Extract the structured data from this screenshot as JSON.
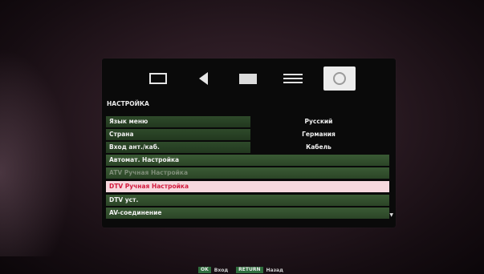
{
  "menu": {
    "icons": [
      {
        "name": "picture-icon",
        "active": false
      },
      {
        "name": "sound-icon",
        "active": false
      },
      {
        "name": "channel-icon",
        "active": false
      },
      {
        "name": "options-icon",
        "active": false
      },
      {
        "name": "setup-icon",
        "active": true
      }
    ],
    "section_title": "НАСТРОЙКА",
    "items": [
      {
        "label": "Язык меню",
        "value": "Русский"
      },
      {
        "label": "Страна",
        "value": "Германия"
      },
      {
        "label": "Вход ант./каб.",
        "value": "Кабель"
      },
      {
        "label": "Автомат. Настройка",
        "value": ""
      },
      {
        "label": "ATV Ручная Настройка",
        "value": ""
      },
      {
        "label": "DTV Ручная Настройка",
        "value": ""
      },
      {
        "label": "DTV уст.",
        "value": ""
      },
      {
        "label": "AV-соединение",
        "value": ""
      }
    ],
    "selected_index": 5,
    "scroll_indicator": "▼"
  },
  "footer": {
    "ok_key": "OK",
    "ok_label": "Вход",
    "return_key": "RETURN",
    "return_label": "Назад"
  },
  "colors": {
    "row_green": "#2b4527",
    "selected_bg": "#f6d8de",
    "selected_text": "#d21b3e",
    "key_green": "#2f6d3d"
  }
}
